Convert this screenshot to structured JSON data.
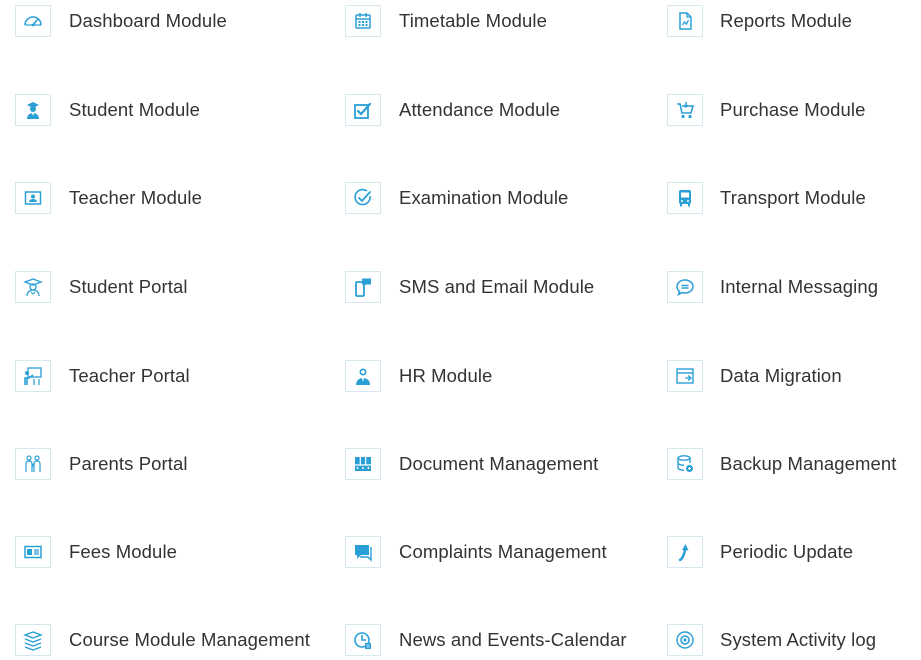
{
  "accent_color": "#2a9fd6",
  "modules": [
    {
      "label": "Dashboard Module",
      "icon": "gauge-icon"
    },
    {
      "label": "Timetable Module",
      "icon": "calendar-icon"
    },
    {
      "label": "Reports Module",
      "icon": "report-document-icon"
    },
    {
      "label": "Student Module",
      "icon": "graduate-student-icon"
    },
    {
      "label": "Attendance Module",
      "icon": "checkbox-icon"
    },
    {
      "label": "Purchase Module",
      "icon": "cart-icon"
    },
    {
      "label": "Teacher Module",
      "icon": "teacher-id-card-icon"
    },
    {
      "label": "Examination Module",
      "icon": "exam-check-icon"
    },
    {
      "label": "Transport Module",
      "icon": "bus-icon"
    },
    {
      "label": "Student Portal",
      "icon": "student-portal-icon"
    },
    {
      "label": "SMS and Email Module",
      "icon": "mobile-message-icon"
    },
    {
      "label": "Internal Messaging",
      "icon": "chat-bubble-icon"
    },
    {
      "label": "Teacher Portal",
      "icon": "teacher-board-icon"
    },
    {
      "label": "HR Module",
      "icon": "hr-person-icon"
    },
    {
      "label": "Data Migration",
      "icon": "data-migration-icon"
    },
    {
      "label": "Parents Portal",
      "icon": "parents-family-icon"
    },
    {
      "label": "Document Management",
      "icon": "document-cabinet-icon"
    },
    {
      "label": "Backup Management",
      "icon": "database-backup-icon"
    },
    {
      "label": "Fees Module",
      "icon": "fees-card-icon"
    },
    {
      "label": "Complaints Management",
      "icon": "complaint-chat-icon"
    },
    {
      "label": "Periodic Update",
      "icon": "update-arrow-icon"
    },
    {
      "label": "Course Module Management",
      "icon": "course-stack-icon"
    },
    {
      "label": "News and Events-Calendar",
      "icon": "news-clock-icon"
    },
    {
      "label": "System Activity log",
      "icon": "activity-log-icon"
    }
  ]
}
